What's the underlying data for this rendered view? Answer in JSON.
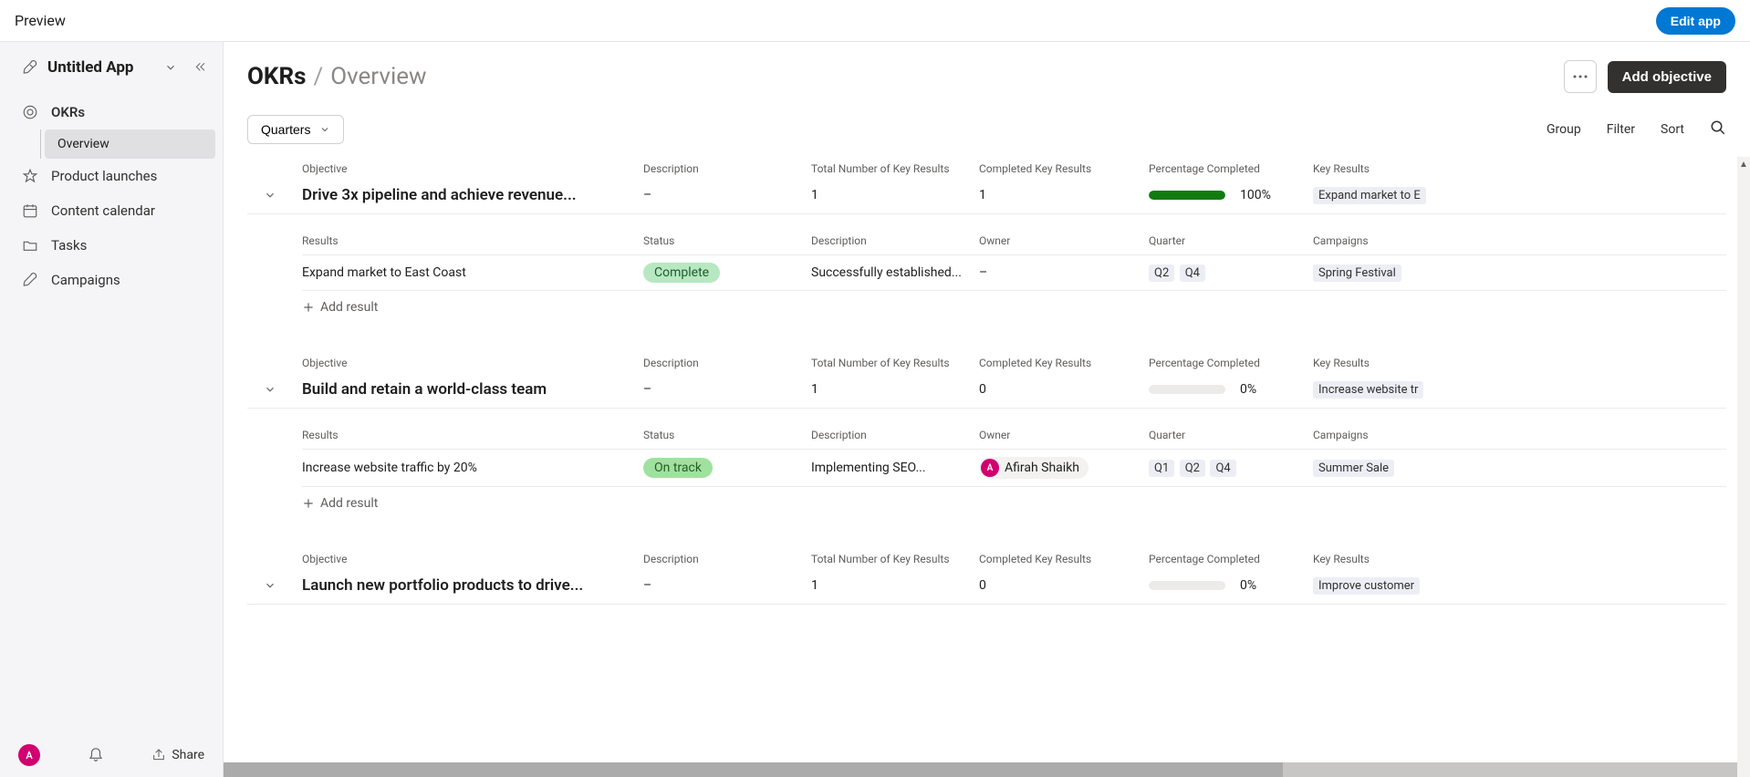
{
  "topbar": {
    "preview_label": "Preview",
    "edit_app_label": "Edit app"
  },
  "sidebar": {
    "app_title": "Untitled App",
    "items": [
      {
        "label": "OKRs",
        "icon": "target",
        "bold": true
      },
      {
        "label": "Product launches",
        "icon": "star"
      },
      {
        "label": "Content calendar",
        "icon": "calendar"
      },
      {
        "label": "Tasks",
        "icon": "folder"
      },
      {
        "label": "Campaigns",
        "icon": "rocket"
      }
    ],
    "sub_item": "Overview",
    "share_label": "Share",
    "avatar_letter": "A"
  },
  "header": {
    "title": "OKRs",
    "page": "Overview",
    "add_objective_label": "Add objective"
  },
  "toolbar": {
    "quarters_label": "Quarters",
    "group_label": "Group",
    "filter_label": "Filter",
    "sort_label": "Sort"
  },
  "columns_obj": {
    "objective": "Objective",
    "description": "Description",
    "total": "Total Number of Key Results",
    "completed": "Completed Key Results",
    "pct": "Percentage Completed",
    "key_results": "Key Results"
  },
  "columns_res": {
    "results": "Results",
    "status": "Status",
    "description": "Description",
    "owner": "Owner",
    "quarter": "Quarter",
    "campaigns": "Campaigns"
  },
  "add_result_label": "Add result",
  "groups": [
    {
      "objective": "Drive 3x pipeline and achieve revenue...",
      "description": "–",
      "total": "1",
      "completed": "1",
      "pct_text": "100%",
      "pct_val": 100,
      "key_result_tag": "Expand market to E",
      "results": [
        {
          "name": "Expand market to East Coast",
          "status": "Complete",
          "status_class": "pill-complete",
          "description": "Successfully established...",
          "owner": "–",
          "owner_avatar": "",
          "quarters": [
            "Q2",
            "Q4"
          ],
          "campaigns": [
            "Spring Festival"
          ]
        }
      ]
    },
    {
      "objective": "Build and retain a world-class team",
      "description": "–",
      "total": "1",
      "completed": "0",
      "pct_text": "0%",
      "pct_val": 0,
      "key_result_tag": "Increase website tr",
      "results": [
        {
          "name": "Increase website traffic by 20%",
          "status": "On track",
          "status_class": "pill-ontrack",
          "description": "Implementing SEO...",
          "owner": "Afirah Shaikh",
          "owner_avatar": "A",
          "quarters": [
            "Q1",
            "Q2",
            "Q4"
          ],
          "campaigns": [
            "Summer Sale"
          ]
        }
      ]
    },
    {
      "objective": "Launch new portfolio products to drive...",
      "description": "–",
      "total": "1",
      "completed": "0",
      "pct_text": "0%",
      "pct_val": 0,
      "key_result_tag": "Improve customer",
      "results": []
    }
  ]
}
